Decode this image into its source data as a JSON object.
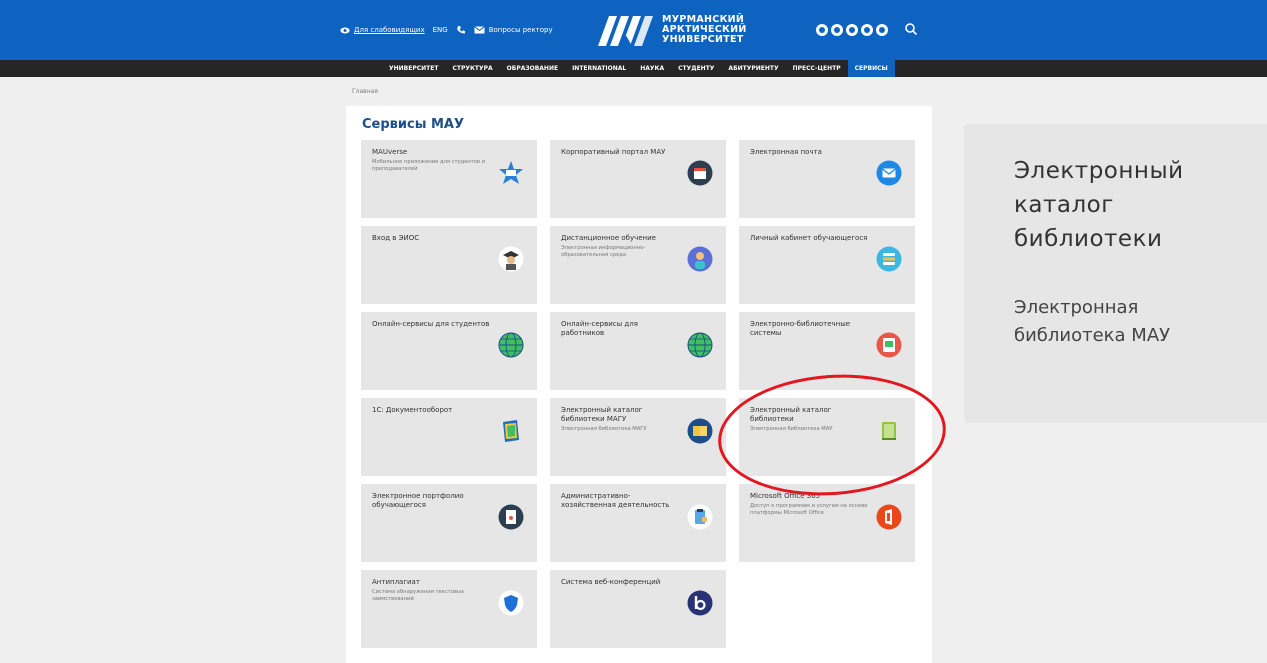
{
  "header": {
    "accessibility_label": "Для слабовидящих",
    "lang_label": "ENG",
    "rector_label": "Вопросы ректору",
    "logo_lines": [
      "МУРМАНСКИЙ",
      "АРКТИЧЕСКИЙ",
      "УНИВЕРСИТЕТ"
    ],
    "brand_color": "#0f63c0",
    "socials": [
      "vk-icon",
      "ok-icon",
      "youtube-icon",
      "telegram-icon",
      "rutube-icon"
    ]
  },
  "nav": {
    "items": [
      "УНИВЕРСИТЕТ",
      "СТРУКТУРА",
      "ОБРАЗОВАНИЕ",
      "INTERNATIONAL",
      "НАУКА",
      "СТУДЕНТУ",
      "АБИТУРИЕНТУ",
      "ПРЕСС-ЦЕНТР",
      "СЕРВИСЫ"
    ],
    "active": "СЕРВИСЫ"
  },
  "breadcrumb": "Главная",
  "services": {
    "title": "Сервисы МАУ",
    "cards": [
      {
        "title": "MAUverse",
        "subtitle": "Мобильное приложение для студентов и преподавателей",
        "icon": "star-app-icon"
      },
      {
        "title": "Корпоративный портал МАУ",
        "subtitle": "",
        "icon": "calendar-icon"
      },
      {
        "title": "Электронная почта",
        "subtitle": "",
        "icon": "mail-icon"
      },
      {
        "title": "Вход в ЭИОС",
        "subtitle": "",
        "icon": "graduate-icon"
      },
      {
        "title": "Дистанционное обучение",
        "subtitle": "Электронная информационно-образовательная среда",
        "icon": "student-icon"
      },
      {
        "title": "Личный кабинет обучающегося",
        "subtitle": "",
        "icon": "list-icon"
      },
      {
        "title": "Онлайн-сервисы для студентов",
        "subtitle": "",
        "icon": "globe-icon"
      },
      {
        "title": "Онлайн-сервисы для работников",
        "subtitle": "",
        "icon": "globe-icon"
      },
      {
        "title": "Электронно-библиотечные системы",
        "subtitle": "",
        "icon": "ebook-icon"
      },
      {
        "title": "1С: Документооборот",
        "subtitle": "",
        "icon": "folder-icon"
      },
      {
        "title": "Электронный каталог библиотеки МАГУ",
        "subtitle": "Электронная библиотека МАГУ",
        "icon": "book-icon"
      },
      {
        "title": "Электронный каталог библиотеки",
        "subtitle": "Электронная библиотека МАУ",
        "icon": "green-book-icon"
      },
      {
        "title": "Электронное портфолио обучающегося",
        "subtitle": "",
        "icon": "portfolio-icon"
      },
      {
        "title": "Административно-хозяйственная деятельность",
        "subtitle": "",
        "icon": "clipboard-icon"
      },
      {
        "title": "Microsoft Office 365",
        "subtitle": "Доступ к программам и услугам на основе платформы Microsoft Office",
        "icon": "office-icon"
      },
      {
        "title": "Антиплагиат",
        "subtitle": "Система обнаружения текстовых заимствований",
        "icon": "shield-icon"
      },
      {
        "title": "Система веб-конференций",
        "subtitle": "",
        "icon": "bbb-icon"
      }
    ]
  },
  "side_card": {
    "title": "Электронный каталог библиотеки",
    "subtitle": "Электронная библиотека МАУ"
  }
}
